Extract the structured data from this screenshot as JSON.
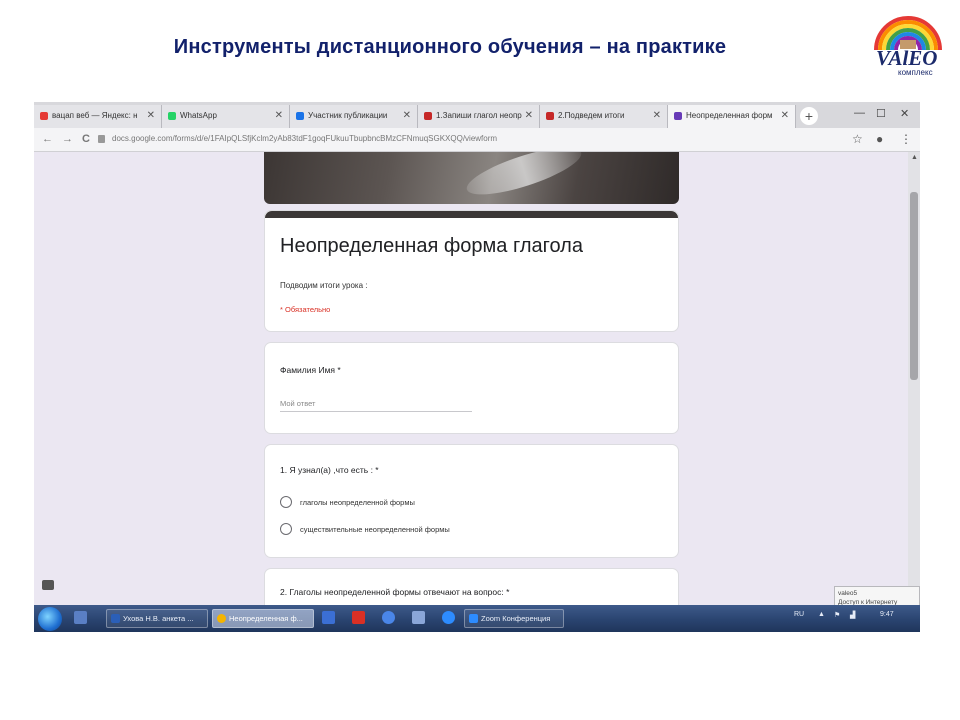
{
  "slide": {
    "title": "Инструменты дистанционного обучения – на практике"
  },
  "logo": {
    "text": "VAlEO",
    "subtitle": "комплекс"
  },
  "browser": {
    "tabs": [
      {
        "label": "вацап веб — Яндекс: н",
        "fav_color": "#e53935"
      },
      {
        "label": "WhatsApp",
        "fav_color": "#25d366"
      },
      {
        "label": "Участник публикации",
        "fav_color": "#1a73e8"
      },
      {
        "label": "1.Запиши глагол неопр",
        "fav_color": "#c62828"
      },
      {
        "label": "2.Подведем итоги",
        "fav_color": "#c62828"
      },
      {
        "label": "Неопределенная форм",
        "fav_color": "#673ab7"
      }
    ],
    "url": "docs.google.com/forms/d/e/1FAIpQLSfjKclm2yAb83tdF1goqFUkuuTbupbncBMzCFNmuqSGKXQQ/viewform",
    "new_tab_label": "+",
    "nav": {
      "back": "←",
      "forward": "→",
      "reload": "C"
    },
    "window_controls": {
      "minimize": "—",
      "maximize": "☐",
      "close": "✕"
    },
    "addr_icons": {
      "star": "☆",
      "account": "●",
      "menu": "⋮"
    }
  },
  "form": {
    "title": "Неопределенная форма глагола",
    "description": "Подводим   итоги урока :",
    "required_note": "* Обязательно",
    "q_name": {
      "title": "Фамилия Имя *",
      "placeholder": "Мой ответ"
    },
    "q1": {
      "title": "1. Я узнал(а) ,что есть : *",
      "options": [
        "глаголы неопределенной формы",
        "существительные неопределенной формы"
      ]
    },
    "q2": {
      "title": "2. Глаголы неопределенной формы отвечают на вопрос: *"
    }
  },
  "notification": {
    "line1": "valeo5",
    "line2": "Доступ к Интернету"
  },
  "taskbar": {
    "buttons": [
      {
        "label": "Ухова Н.В. анкета ...",
        "active": false
      },
      {
        "label": "Неопределенная ф...",
        "active": true
      },
      {
        "label": "Zoom Конференция",
        "active": false
      }
    ],
    "tray": {
      "lang": "RU",
      "clock": "9:47"
    }
  },
  "colors": {
    "title_blue": "#12216b",
    "required_red": "#d93025",
    "taskbar_blue": "#2a4470",
    "form_accent": "#3b3736"
  }
}
